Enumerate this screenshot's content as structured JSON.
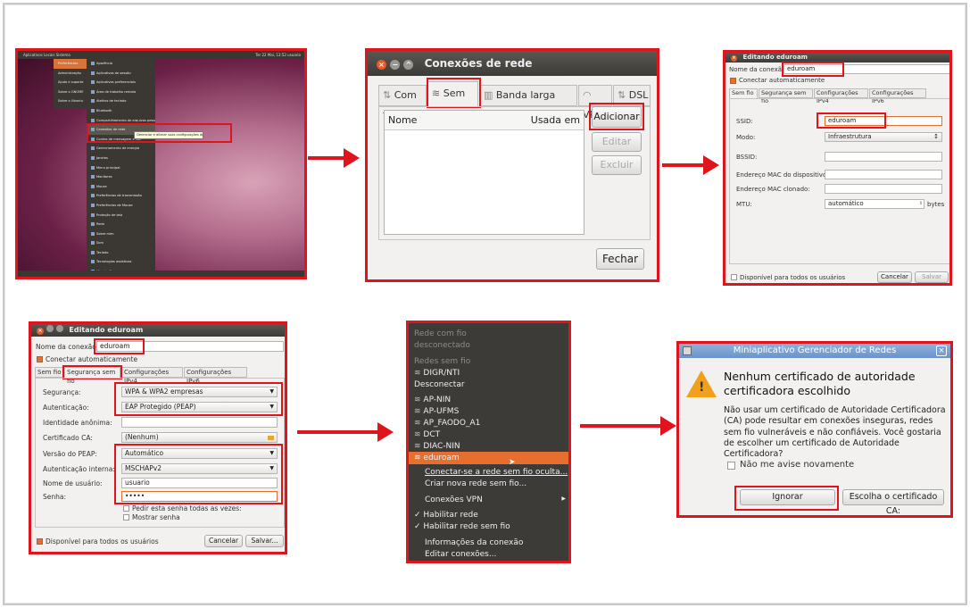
{
  "p1": {
    "topbar": "Aplicativos  Locais  Sistema",
    "topright": "Ter 22 Mai, 13:52  usuario",
    "menu_a": [
      "Preferências",
      "Administração",
      "Ajuda e suporte",
      "Sobre o GNOME",
      "Sobre o Ubuntu"
    ],
    "menu_b": [
      "Aparência",
      "Aplicativos de sessão",
      "Aplicativos preferenciais",
      "Área de trabalho remota",
      "Atalhos de teclado",
      "Bluetooth",
      "Compartilhamento de arquivos pessoais",
      "Conexões de rede",
      "Contas de mensagem e VoIP",
      "Gerenciamento de energia",
      "Janelas",
      "Menu principal",
      "Monitores",
      "Mouse",
      "Preferências de transmissão",
      "Preferências de Mouse",
      "Proteção de tela",
      "Rede",
      "Sobre mim",
      "Som",
      "Teclado",
      "Tecnologias assistivas",
      "Ubuntu One"
    ],
    "tooltip": "Gerenciar e alterar suas configurações de conexão de rede"
  },
  "p2": {
    "title": "Conexões de rede",
    "tabs": [
      "Com fio",
      "Sem fio",
      "Banda larga móvel",
      "VPN",
      "DSL"
    ],
    "col_name": "Nome",
    "col_used": "Usada em",
    "btn_add": "Adicionar",
    "btn_edit": "Editar",
    "btn_delete": "Excluir",
    "btn_close": "Fechar"
  },
  "p3": {
    "title": "Editando eduroam",
    "name_label": "Nome da conexão:",
    "name_value": "eduroam",
    "auto": "Conectar automaticamente",
    "tabs": [
      "Sem fio",
      "Segurança sem fio",
      "Configurações IPv4",
      "Configurações IPv6"
    ],
    "ssid_label": "SSID:",
    "ssid_value": "eduroam",
    "mode_label": "Modo:",
    "mode_value": "Infraestrutura",
    "bssid_label": "BSSID:",
    "mac_label": "Endereço MAC do dispositivo:",
    "clone_label": "Endereço MAC clonado:",
    "mtu_label": "MTU:",
    "mtu_value": "automático",
    "mtu_unit": "bytes",
    "all_users": "Disponível para todos os usuários",
    "cancel": "Cancelar",
    "save": "Salvar"
  },
  "p4": {
    "title": "Editando eduroam",
    "name_label": "Nome da conexão:",
    "name_value": "eduroam",
    "auto": "Conectar automaticamente",
    "tabs": [
      "Sem fio",
      "Segurança sem fio",
      "Configurações IPv4",
      "Configurações IPv6"
    ],
    "sec_label": "Segurança:",
    "sec_value": "WPA & WPA2 empresas",
    "auth_label": "Autenticação:",
    "auth_value": "EAP Protegido (PEAP)",
    "anon_label": "Identidade anônima:",
    "ca_label": "Certificado CA:",
    "ca_value": "(Nenhum)",
    "peap_label": "Versão do PEAP:",
    "peap_value": "Automático",
    "inner_label": "Autenticação interna:",
    "inner_value": "MSCHAPv2",
    "user_label": "Nome de usuário:",
    "user_value": "usuario",
    "pass_label": "Senha:",
    "pass_value": "•••••",
    "ask": "Pedir esta senha todas as vezes:",
    "show": "Mostrar senha",
    "all_users": "Disponível para todos os usuários",
    "cancel": "Cancelar",
    "save": "Salvar..."
  },
  "p5": {
    "wired_h": "Rede com fio",
    "wired_s": "desconectado",
    "wifi_h": "Redes sem fio",
    "cur": "DIGR/NTI",
    "disc": "Desconectar",
    "nets": [
      "AP-NIN",
      "AP-UFMS",
      "AP_FAODO_A1",
      "DCT",
      "DIAC-NIN"
    ],
    "sel": "eduroam",
    "hidden": "Conectar-se a rede sem fio oculta...",
    "newnet": "Criar nova rede sem fio...",
    "vpn": "Conexões VPN",
    "en_net": "Habilitar rede",
    "en_wifi": "Habilitar rede sem fio",
    "info": "Informações da conexão",
    "edit": "Editar conexões..."
  },
  "p6": {
    "title": "Miniaplicativo Gerenciador de Redes",
    "heading": "Nenhum certificado de autoridade certificadora escolhido",
    "body": "Não usar um certificado de Autoridade Certificadora (CA) pode resultar em conexões inseguras, redes sem fio vulneráveis e não confiáveis. Você gostaria de escolher um certificado de Autoridade Certificadora?",
    "noask": "Não me avise novamente",
    "ignore": "Ignorar",
    "choose": "Escolha o certificado CA:"
  }
}
